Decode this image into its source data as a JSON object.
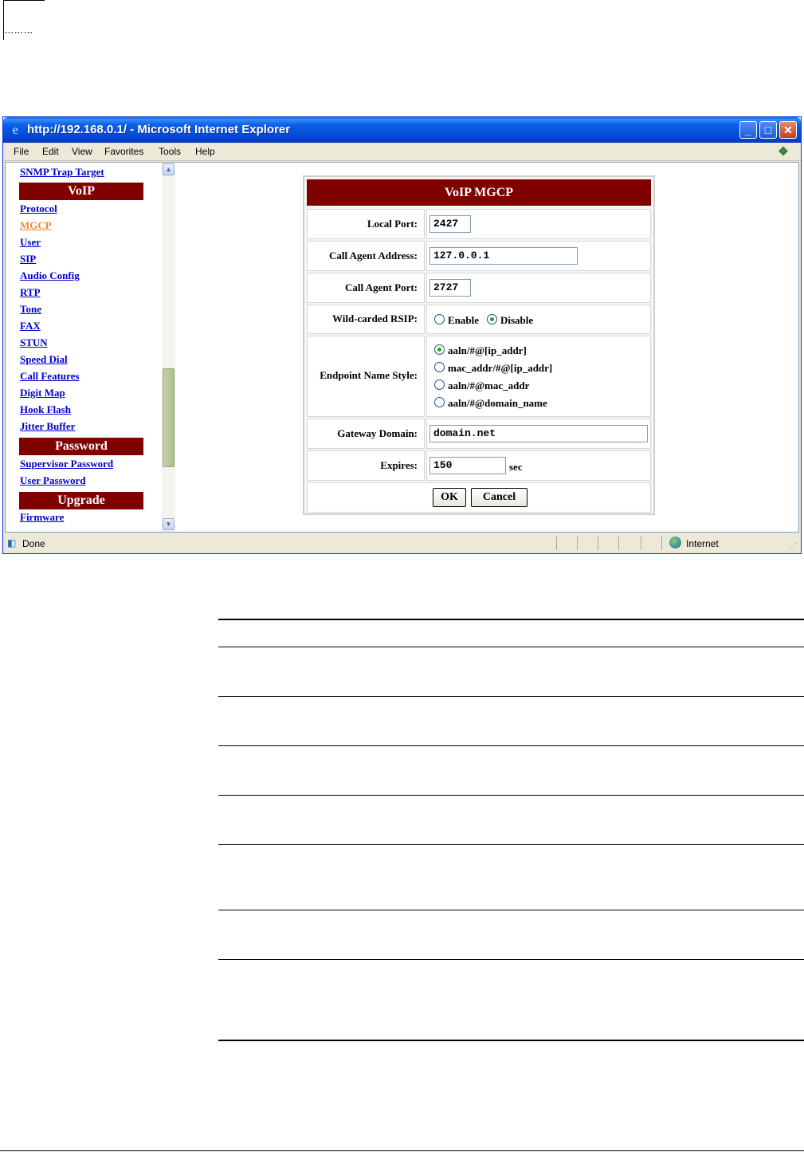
{
  "window": {
    "title": "http://192.168.0.1/ - Microsoft Internet Explorer",
    "minimize": "_",
    "maximize": "□",
    "close": "✕"
  },
  "menu": [
    "File",
    "Edit",
    "View",
    "Favorites",
    "Tools",
    "Help"
  ],
  "nav": {
    "top_link": "SNMP Trap Target",
    "voip_header": "VoIP",
    "voip_links": [
      "Protocol",
      "MGCP",
      "User",
      "SIP",
      "Audio Config",
      "RTP",
      "Tone",
      "FAX",
      "STUN",
      "Speed Dial",
      "Call Features",
      "Digit Map",
      "Hook Flash",
      "Jitter Buffer"
    ],
    "active_link": "MGCP",
    "password_header": "Password",
    "password_links": [
      "Supervisor Password",
      "User Password"
    ],
    "upgrade_header": "Upgrade",
    "upgrade_links": [
      "Firmware"
    ]
  },
  "form": {
    "title": "VoIP MGCP",
    "local_port_label": "Local Port:",
    "local_port": "2427",
    "call_agent_address_label": "Call Agent Address:",
    "call_agent_address": "127.0.0.1",
    "call_agent_port_label": "Call Agent Port:",
    "call_agent_port": "2727",
    "rsip_label": "Wild-carded RSIP:",
    "rsip_enable": "Enable",
    "rsip_disable": "Disable",
    "rsip_selected": "Disable",
    "endpoint_label": "Endpoint Name Style:",
    "endpoint_options": [
      "aaln/#@[ip_addr]",
      "mac_addr/#@[ip_addr]",
      "aaln/#@mac_addr",
      "aaln/#@domain_name"
    ],
    "endpoint_selected": "aaln/#@[ip_addr]",
    "gateway_domain_label": "Gateway Domain:",
    "gateway_domain": "domain.net",
    "expires_label": "Expires:",
    "expires": "150",
    "expires_unit": "sec",
    "ok": "OK",
    "cancel": "Cancel"
  },
  "status": {
    "text": "Done",
    "zone": "Internet"
  },
  "page": {
    "corner_dots": "⋯⋯⋯"
  }
}
